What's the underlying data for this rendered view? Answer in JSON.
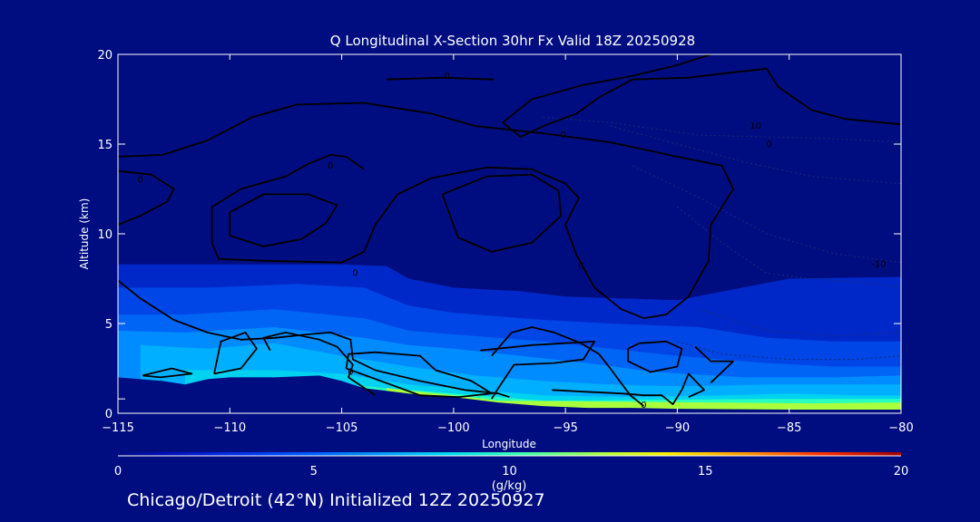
{
  "chart_data": {
    "type": "heatmap",
    "title": "Q Longitudinal X-Section 30hr  Fx Valid 18Z 20250928",
    "xlabel": "Longitude",
    "ylabel": "Altitude (km)",
    "xlim": [
      -115,
      -80
    ],
    "ylim": [
      0,
      20
    ],
    "x_ticks": [
      "−115",
      "−110",
      "−105",
      "−100",
      "−95",
      "−90",
      "−85",
      "−80"
    ],
    "x_tick_values": [
      -115,
      -110,
      -105,
      -100,
      -95,
      -90,
      -85,
      -80
    ],
    "y_ticks": [
      "0",
      "5",
      "10",
      "15",
      "20"
    ],
    "y_tick_values": [
      0,
      5,
      10,
      15,
      20
    ],
    "colorbar": {
      "label": "(g/kg)",
      "range": [
        0,
        20
      ],
      "ticks": [
        "0",
        "5",
        "10",
        "15",
        "20"
      ],
      "tick_values": [
        0,
        5,
        10,
        15,
        20
      ]
    },
    "terrain_surface_km": [
      [
        -115,
        2.0
      ],
      [
        -114,
        1.9
      ],
      [
        -113,
        1.8
      ],
      [
        -112,
        1.6
      ],
      [
        -111,
        1.9
      ],
      [
        -110,
        2.0
      ],
      [
        -108,
        2.0
      ],
      [
        -106,
        2.1
      ],
      [
        -105,
        1.8
      ],
      [
        -104,
        1.4
      ],
      [
        -102,
        1.1
      ],
      [
        -100,
        0.9
      ],
      [
        -98,
        0.6
      ],
      [
        -96,
        0.4
      ],
      [
        -94,
        0.3
      ],
      [
        -92,
        0.3
      ],
      [
        -90,
        0.25
      ],
      [
        -85,
        0.2
      ],
      [
        -80,
        0.2
      ]
    ],
    "moist_layer_top_km": [
      [
        -115,
        8.3
      ],
      [
        -110,
        8.3
      ],
      [
        -105,
        8.3
      ],
      [
        -103,
        8.2
      ],
      [
        -102,
        7.5
      ],
      [
        -100,
        7.0
      ],
      [
        -97,
        6.8
      ],
      [
        -95,
        6.5
      ],
      [
        -93,
        6.3
      ],
      [
        -90,
        6.3
      ],
      [
        -85,
        7.5
      ],
      [
        -80,
        7.6
      ]
    ],
    "q_bands_gkg": [
      {
        "level": 2,
        "top_km": [
          [
            -115,
            8.3
          ],
          [
            -110,
            8.3
          ],
          [
            -105,
            8.3
          ],
          [
            -103,
            8.2
          ],
          [
            -102,
            7.5
          ],
          [
            -100,
            7.0
          ],
          [
            -97,
            6.8
          ],
          [
            -95,
            6.5
          ],
          [
            -90,
            6.3
          ],
          [
            -85,
            7.5
          ],
          [
            -80,
            7.6
          ]
        ]
      },
      {
        "level": 3,
        "top_km": [
          [
            -115,
            7.0
          ],
          [
            -111,
            7.0
          ],
          [
            -107,
            7.2
          ],
          [
            -104,
            7.0
          ],
          [
            -102,
            6.0
          ],
          [
            -100,
            5.6
          ],
          [
            -96,
            5.2
          ],
          [
            -93,
            5.0
          ],
          [
            -89,
            4.8
          ],
          [
            -86,
            4.2
          ],
          [
            -83,
            4.0
          ],
          [
            -80,
            4.0
          ]
        ]
      },
      {
        "level": 4,
        "top_km": [
          [
            -115,
            5.5
          ],
          [
            -112,
            5.5
          ],
          [
            -108,
            5.8
          ],
          [
            -104,
            5.3
          ],
          [
            -102,
            4.6
          ],
          [
            -99,
            4.3
          ],
          [
            -96,
            4.0
          ],
          [
            -93,
            3.6
          ],
          [
            -90,
            3.2
          ],
          [
            -86,
            2.8
          ],
          [
            -83,
            2.6
          ],
          [
            -80,
            2.6
          ]
        ]
      },
      {
        "level": 5,
        "top_km": [
          [
            -115,
            4.6
          ],
          [
            -112,
            4.5
          ],
          [
            -108,
            4.8
          ],
          [
            -104,
            4.2
          ],
          [
            -102,
            3.8
          ],
          [
            -100,
            3.6
          ],
          [
            -97,
            3.2
          ],
          [
            -94,
            2.8
          ],
          [
            -91,
            2.3
          ],
          [
            -87,
            2.0
          ],
          [
            -83,
            2.0
          ],
          [
            -80,
            2.1
          ]
        ]
      },
      {
        "level": 6,
        "top_km": [
          [
            -114,
            3.8
          ],
          [
            -111,
            3.6
          ],
          [
            -108,
            3.9
          ],
          [
            -105,
            3.2
          ],
          [
            -102,
            2.6
          ],
          [
            -99,
            2.1
          ],
          [
            -96,
            1.8
          ],
          [
            -93,
            1.6
          ],
          [
            -90,
            1.5
          ],
          [
            -86,
            1.6
          ],
          [
            -83,
            1.6
          ],
          [
            -80,
            1.6
          ]
        ]
      },
      {
        "level": 8,
        "top_km": [
          [
            -112,
            2.4
          ],
          [
            -108,
            2.4
          ],
          [
            -105,
            2.2
          ],
          [
            -102,
            1.6
          ],
          [
            -99,
            1.3
          ],
          [
            -96,
            1.0
          ],
          [
            -92,
            0.9
          ],
          [
            -88,
            1.0
          ],
          [
            -85,
            1.1
          ],
          [
            -82,
            1.0
          ],
          [
            -80,
            1.0
          ]
        ]
      },
      {
        "level": 10,
        "top_km": [
          [
            -105,
            1.6
          ],
          [
            -102,
            1.3
          ],
          [
            -100,
            1.1
          ],
          [
            -98,
            0.9
          ],
          [
            -96,
            0.7
          ],
          [
            -86,
            0.8
          ],
          [
            -83,
            0.8
          ],
          [
            -80,
            0.8
          ]
        ]
      },
      {
        "level": 12,
        "top_km": [
          [
            -103,
            1.4
          ],
          [
            -100,
            1.0
          ],
          [
            -98,
            0.7
          ],
          [
            -84,
            0.55
          ],
          [
            -80,
            0.6
          ]
        ]
      }
    ],
    "contour_labels": [
      "0",
      "0",
      "0",
      "0",
      "0",
      "0",
      "10",
      "0",
      "0",
      "0",
      "-10"
    ],
    "contours_solid": [
      [
        [
          -115,
          14.3
        ],
        [
          -113,
          14.4
        ],
        [
          -111,
          15.2
        ],
        [
          -109,
          16.5
        ],
        [
          -107,
          17.2
        ],
        [
          -104,
          17.3
        ],
        [
          -101,
          16.7
        ],
        [
          -99,
          16.0
        ],
        [
          -96,
          15.6
        ],
        [
          -93,
          15.1
        ],
        [
          -90,
          14.3
        ],
        [
          -88,
          13.8
        ],
        [
          -87.5,
          12.5
        ],
        [
          -88.5,
          10.5
        ],
        [
          -88.6,
          8.5
        ],
        [
          -89.5,
          6.5
        ],
        [
          -90.5,
          5.5
        ],
        [
          -91.5,
          5.3
        ],
        [
          -92.5,
          5.8
        ],
        [
          -93.7,
          7.0
        ],
        [
          -94.5,
          8.8
        ],
        [
          -95.0,
          10.5
        ],
        [
          -94.4,
          12.0
        ],
        [
          -95.0,
          12.8
        ],
        [
          -96.5,
          13.6
        ],
        [
          -98.5,
          13.7
        ],
        [
          -101,
          13.1
        ],
        [
          -102.5,
          12.2
        ],
        [
          -103.5,
          10.5
        ],
        [
          -104,
          9.0
        ],
        [
          -105,
          8.4
        ],
        [
          -108.5,
          8.5
        ],
        [
          -110.5,
          8.6
        ],
        [
          -110.8,
          9.5
        ],
        [
          -110.8,
          11.5
        ],
        [
          -109.5,
          12.5
        ],
        [
          -107.5,
          13.2
        ],
        [
          -106.5,
          13.9
        ],
        [
          -105.5,
          14.4
        ],
        [
          -104.8,
          14.3
        ],
        [
          -104,
          13.6
        ]
      ],
      [
        [
          -115,
          13.5
        ],
        [
          -113.5,
          13.3
        ],
        [
          -112.5,
          12.5
        ],
        [
          -112.8,
          11.8
        ],
        [
          -114,
          11.0
        ],
        [
          -115,
          10.5
        ]
      ],
      [
        [
          -110,
          11.2
        ],
        [
          -108.5,
          12.2
        ],
        [
          -106.5,
          12.2
        ],
        [
          -105.2,
          11.6
        ],
        [
          -105.7,
          10.6
        ],
        [
          -106.8,
          9.7
        ],
        [
          -108.5,
          9.3
        ],
        [
          -110,
          9.9
        ],
        [
          -110,
          11.2
        ]
      ],
      [
        [
          -100.5,
          12.2
        ],
        [
          -98.5,
          13.2
        ],
        [
          -96.5,
          13.3
        ],
        [
          -95.3,
          12.4
        ],
        [
          -95.2,
          11.0
        ],
        [
          -96.5,
          9.5
        ],
        [
          -98.3,
          9.0
        ],
        [
          -99.8,
          9.8
        ],
        [
          -100.5,
          12.2
        ]
      ],
      [
        [
          -80,
          16.1
        ],
        [
          -82.5,
          16.4
        ],
        [
          -84,
          16.9
        ],
        [
          -85.5,
          18.2
        ],
        [
          -86,
          19.2
        ],
        [
          -87.5,
          19.0
        ],
        [
          -89.5,
          18.7
        ],
        [
          -92,
          18.6
        ],
        [
          -93.5,
          17.6
        ],
        [
          -94.5,
          16.7
        ],
        [
          -96,
          16.0
        ],
        [
          -97,
          15.4
        ],
        [
          -97.8,
          16.2
        ],
        [
          -96.5,
          17.5
        ],
        [
          -94.2,
          18.3
        ],
        [
          -92,
          18.8
        ],
        [
          -90,
          19.4
        ],
        [
          -88.5,
          20.0
        ]
      ],
      [
        [
          -115,
          7.4
        ],
        [
          -114,
          6.4
        ],
        [
          -112.5,
          5.2
        ],
        [
          -111,
          4.5
        ],
        [
          -109.5,
          4.1
        ],
        [
          -108,
          4.2
        ],
        [
          -106.5,
          4.4
        ],
        [
          -105.5,
          4.5
        ],
        [
          -104.6,
          4.1
        ],
        [
          -104.5,
          3.0
        ],
        [
          -103.5,
          2.4
        ],
        [
          -101.5,
          1.8
        ],
        [
          -99.5,
          1.3
        ],
        [
          -98,
          1.1
        ],
        [
          -97.5,
          0.9
        ]
      ],
      [
        [
          -113.9,
          2.1
        ],
        [
          -112.6,
          2.5
        ],
        [
          -111.7,
          2.2
        ],
        [
          -113.1,
          2.0
        ],
        [
          -113.9,
          2.1
        ]
      ],
      [
        [
          -110.7,
          2.2
        ],
        [
          -110.4,
          4.0
        ],
        [
          -109.3,
          4.5
        ],
        [
          -108.8,
          3.6
        ],
        [
          -109.5,
          2.5
        ],
        [
          -110.7,
          2.2
        ]
      ],
      [
        [
          -108.2,
          3.5
        ],
        [
          -108.5,
          4.2
        ],
        [
          -107.5,
          4.5
        ],
        [
          -106,
          4.1
        ],
        [
          -105.2,
          3.7
        ],
        [
          -104.5,
          2.7
        ],
        [
          -104.7,
          2.0
        ],
        [
          -103.5,
          1.0
        ]
      ],
      [
        [
          -104.8,
          2.5
        ],
        [
          -104.7,
          3.3
        ],
        [
          -103.5,
          3.4
        ],
        [
          -101.5,
          3.2
        ],
        [
          -100.8,
          2.4
        ],
        [
          -99.2,
          1.8
        ],
        [
          -98.3,
          1.1
        ],
        [
          -99.8,
          0.9
        ],
        [
          -101.5,
          1.0
        ],
        [
          -104.8,
          2.5
        ]
      ],
      [
        [
          -98.8,
          3.5
        ],
        [
          -96.5,
          3.8
        ],
        [
          -93.7,
          4.0
        ],
        [
          -94.2,
          3.0
        ],
        [
          -95.5,
          2.8
        ],
        [
          -97.3,
          2.7
        ],
        [
          -98,
          1.4
        ],
        [
          -98.3,
          0.8
        ]
      ],
      [
        [
          -98.3,
          3.2
        ],
        [
          -97.4,
          4.5
        ],
        [
          -96.5,
          4.8
        ],
        [
          -95.5,
          4.5
        ],
        [
          -94.3,
          3.9
        ],
        [
          -93.5,
          3.3
        ],
        [
          -93,
          2.5
        ],
        [
          -92.1,
          1.0
        ],
        [
          -91.5,
          0.4
        ]
      ],
      [
        [
          -92.2,
          3.6
        ],
        [
          -92.2,
          2.9
        ],
        [
          -91.2,
          2.3
        ],
        [
          -90,
          2.6
        ],
        [
          -89.8,
          3.6
        ],
        [
          -90.5,
          4.0
        ],
        [
          -91.7,
          3.9
        ],
        [
          -92.2,
          3.6
        ]
      ],
      [
        [
          -95.6,
          1.3
        ],
        [
          -94.2,
          1.2
        ],
        [
          -92.5,
          1.1
        ],
        [
          -91.5,
          1.0
        ],
        [
          -90.7,
          1.0
        ],
        [
          -90.2,
          0.5
        ],
        [
          -89.8,
          1.3
        ],
        [
          -89.5,
          2.2
        ],
        [
          -88.8,
          1.3
        ],
        [
          -89.5,
          0.9
        ]
      ],
      [
        [
          -89.2,
          3.7
        ],
        [
          -88.5,
          2.9
        ],
        [
          -87.5,
          2.9
        ],
        [
          -88.5,
          1.7
        ]
      ],
      [
        [
          -103,
          18.6
        ],
        [
          -100.5,
          18.7
        ],
        [
          -98.2,
          18.6
        ]
      ]
    ],
    "contours_dashed": [
      [
        [
          -96,
          16.5
        ],
        [
          -93,
          16.2
        ],
        [
          -89,
          15.5
        ],
        [
          -86,
          15.4
        ],
        [
          -83,
          15.3
        ],
        [
          -80,
          15.1
        ]
      ],
      [
        [
          -93,
          16.0
        ],
        [
          -90,
          15.0
        ],
        [
          -87,
          14.0
        ],
        [
          -84,
          13.2
        ],
        [
          -80,
          12.8
        ]
      ],
      [
        [
          -92,
          13.8
        ],
        [
          -89,
          12.0
        ],
        [
          -86,
          10.0
        ],
        [
          -83,
          8.9
        ],
        [
          -80,
          8.4
        ]
      ],
      [
        [
          -90,
          11.5
        ],
        [
          -88,
          9.5
        ],
        [
          -86,
          7.8
        ],
        [
          -84,
          7.5
        ],
        [
          -81,
          7.2
        ],
        [
          -80,
          7.0
        ]
      ],
      [
        [
          -89,
          5.8
        ],
        [
          -86,
          4.6
        ],
        [
          -83,
          4.3
        ],
        [
          -80,
          4.5
        ]
      ],
      [
        [
          -90,
          4.0
        ],
        [
          -88,
          3.3
        ],
        [
          -85,
          3.0
        ],
        [
          -82,
          3.0
        ],
        [
          -80,
          3.2
        ]
      ]
    ]
  },
  "footer": {
    "caption": "Chicago/Detroit (42°N) Initialized 12Z 20250927"
  },
  "colors": {
    "background": "#000d80",
    "contour": "#000000",
    "axis": "#ffffff"
  }
}
